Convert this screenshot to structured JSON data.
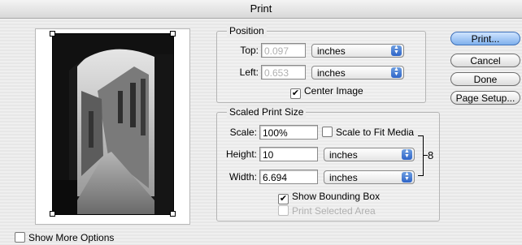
{
  "window": {
    "title": "Print"
  },
  "position": {
    "legend": "Position",
    "top_label": "Top:",
    "top_value": "0.097",
    "top_unit": "inches",
    "left_label": "Left:",
    "left_value": "0.653",
    "left_unit": "inches",
    "center_image_label": "Center Image",
    "center_image_checked": true
  },
  "scaled": {
    "legend": "Scaled Print Size",
    "scale_label": "Scale:",
    "scale_value": "100%",
    "scale_to_fit_label": "Scale to Fit Media",
    "scale_to_fit_checked": false,
    "height_label": "Height:",
    "height_value": "10",
    "height_unit": "inches",
    "width_label": "Width:",
    "width_value": "6.694",
    "width_unit": "inches",
    "show_bbox_label": "Show Bounding Box",
    "show_bbox_checked": true,
    "print_selected_label": "Print Selected Area",
    "print_selected_checked": false
  },
  "buttons": {
    "print": "Print...",
    "cancel": "Cancel",
    "done": "Done",
    "page_setup": "Page Setup..."
  },
  "show_more_options": {
    "label": "Show More Options",
    "checked": false
  },
  "icons": {
    "popup": "popup-arrows-icon",
    "link": "chain-link-icon"
  }
}
